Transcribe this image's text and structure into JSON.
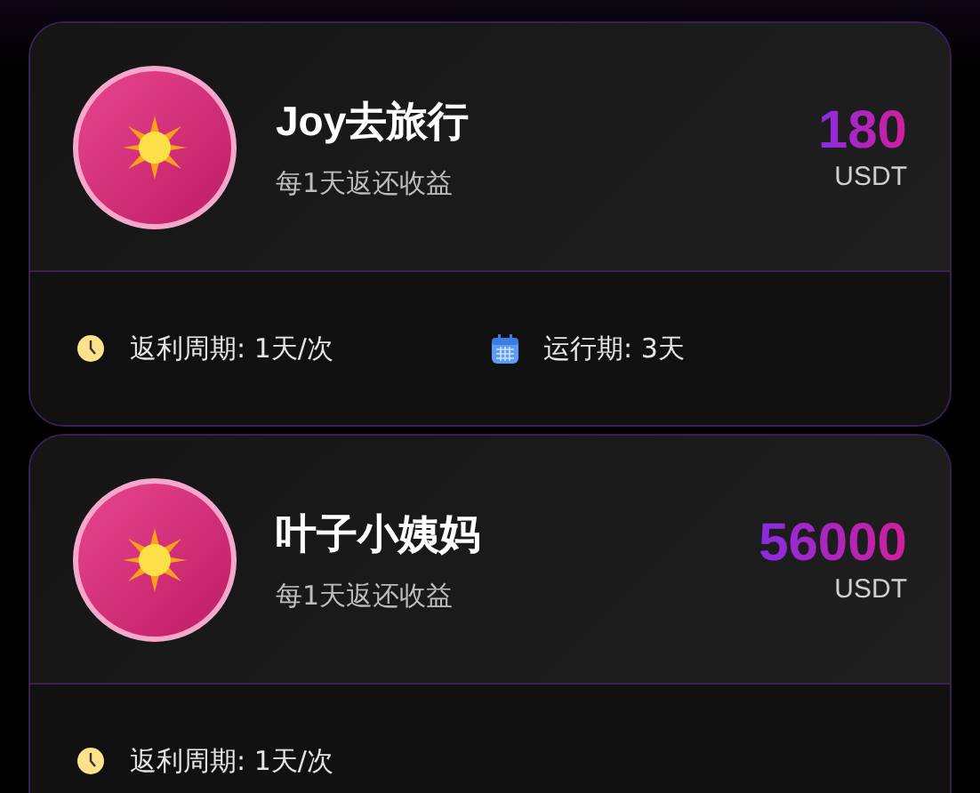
{
  "cards": [
    {
      "title": "Joy去旅行",
      "subtitle": "每1天返还收益",
      "amount": "180",
      "unit": "USDT",
      "details": [
        {
          "kind": "clock",
          "text": "返利周期: 1天/次"
        },
        {
          "kind": "calendar",
          "text": "运行期: 3天"
        }
      ]
    },
    {
      "title": "叶子小姨妈",
      "subtitle": "每1天返还收益",
      "amount": "56000",
      "unit": "USDT",
      "details": [
        {
          "kind": "clock",
          "text": "返利周期: 1天/次"
        }
      ]
    }
  ]
}
